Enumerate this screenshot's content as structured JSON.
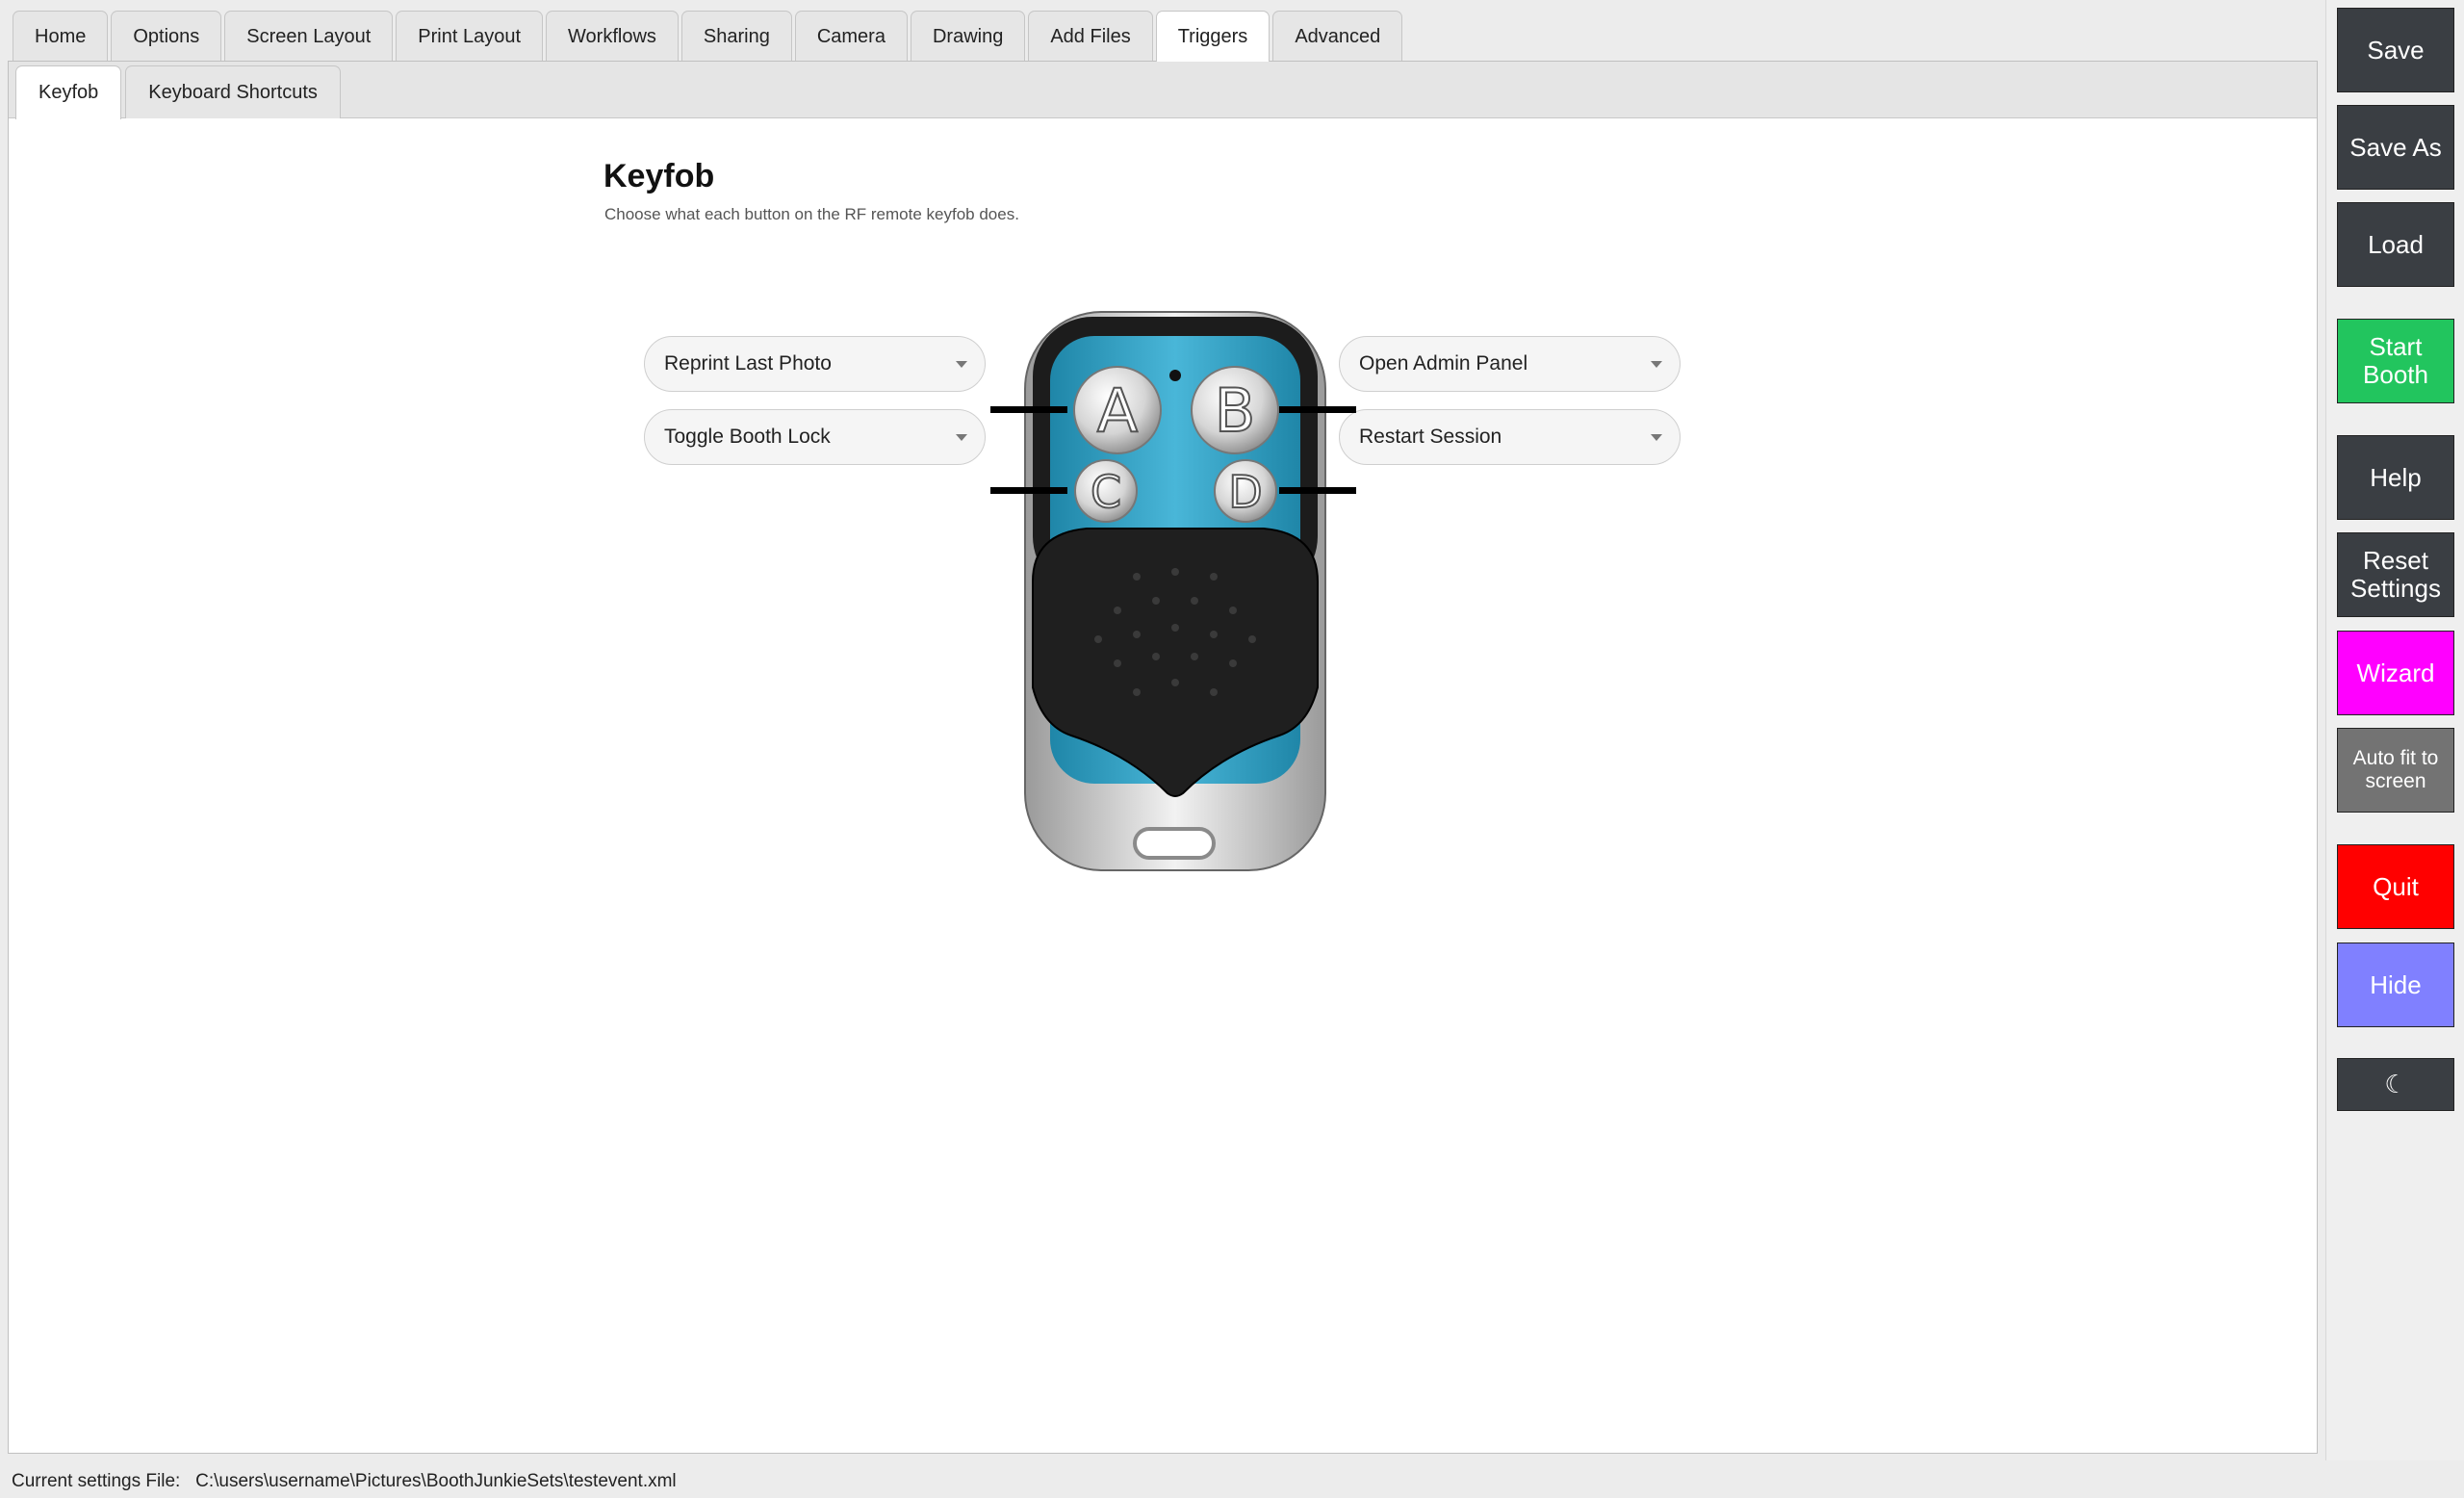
{
  "main_tabs": [
    "Home",
    "Options",
    "Screen Layout",
    "Print Layout",
    "Workflows",
    "Sharing",
    "Camera",
    "Drawing",
    "Add Files",
    "Triggers",
    "Advanced"
  ],
  "active_main_tab": "Triggers",
  "sub_tabs": [
    "Keyfob",
    "Keyboard Shortcuts"
  ],
  "active_sub_tab": "Keyfob",
  "page": {
    "title": "Keyfob",
    "description": "Choose what each button on the RF remote keyfob does."
  },
  "keyfob": {
    "button_letters": [
      "A",
      "B",
      "C",
      "D"
    ],
    "a_action": "Reprint Last Photo",
    "b_action": "Open Admin Panel",
    "c_action": "Toggle Booth Lock",
    "d_action": "Restart Session",
    "body_color": "#3aa6c9"
  },
  "sidebar": {
    "save": "Save",
    "save_as": "Save As",
    "load": "Load",
    "start_booth": "Start Booth",
    "help": "Help",
    "reset_settings": "Reset Settings",
    "wizard": "Wizard",
    "auto_fit": "Auto fit to screen",
    "quit": "Quit",
    "hide": "Hide",
    "theme_toggle": "☾"
  },
  "colors": {
    "dark_button": "#3a3e43",
    "start_booth": "#22c55e",
    "wizard": "#ff00ff",
    "auto_fit": "#737373",
    "quit": "#ff0000",
    "hide": "#8080ff"
  },
  "status": {
    "label": "Current settings File:",
    "path": "C:\\users\\username\\Pictures\\BoothJunkieSets\\testevent.xml"
  }
}
